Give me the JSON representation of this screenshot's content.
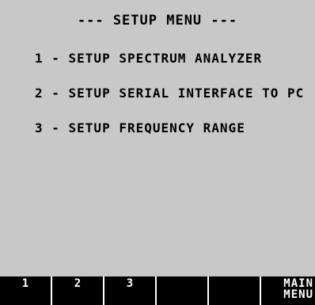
{
  "screen": {
    "title": "--- SETUP MENU ---",
    "menu_items": [
      {
        "label": "1 - SETUP SPECTRUM ANALYZER"
      },
      {
        "label": "2 - SETUP SERIAL INTERFACE TO PC"
      },
      {
        "label": "3 - SETUP FREQUENCY RANGE"
      }
    ]
  },
  "softkeys": [
    {
      "label": "1"
    },
    {
      "label": "2"
    },
    {
      "label": "3"
    },
    {
      "label": ""
    },
    {
      "label": ""
    },
    {
      "label": "MAIN\nMENU"
    }
  ],
  "colors": {
    "screen_background": "#c8c8c8",
    "text": "#000000",
    "softkey_bar": "#000000",
    "softkey_text": "#ffffff"
  }
}
